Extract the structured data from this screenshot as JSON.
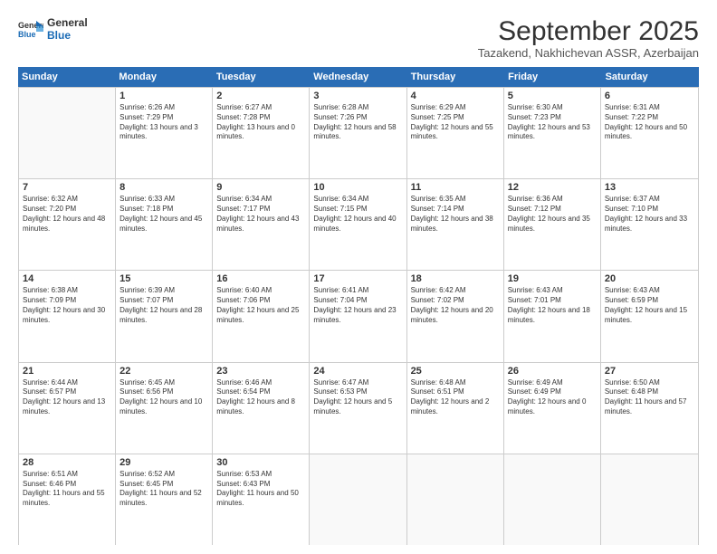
{
  "logo": {
    "line1": "General",
    "line2": "Blue"
  },
  "title": "September 2025",
  "location": "Tazakend, Nakhichevan ASSR, Azerbaijan",
  "days_of_week": [
    "Sunday",
    "Monday",
    "Tuesday",
    "Wednesday",
    "Thursday",
    "Friday",
    "Saturday"
  ],
  "weeks": [
    [
      {
        "day": "",
        "empty": true
      },
      {
        "day": "1",
        "sunrise": "Sunrise: 6:26 AM",
        "sunset": "Sunset: 7:29 PM",
        "daylight": "Daylight: 13 hours and 3 minutes."
      },
      {
        "day": "2",
        "sunrise": "Sunrise: 6:27 AM",
        "sunset": "Sunset: 7:28 PM",
        "daylight": "Daylight: 13 hours and 0 minutes."
      },
      {
        "day": "3",
        "sunrise": "Sunrise: 6:28 AM",
        "sunset": "Sunset: 7:26 PM",
        "daylight": "Daylight: 12 hours and 58 minutes."
      },
      {
        "day": "4",
        "sunrise": "Sunrise: 6:29 AM",
        "sunset": "Sunset: 7:25 PM",
        "daylight": "Daylight: 12 hours and 55 minutes."
      },
      {
        "day": "5",
        "sunrise": "Sunrise: 6:30 AM",
        "sunset": "Sunset: 7:23 PM",
        "daylight": "Daylight: 12 hours and 53 minutes."
      },
      {
        "day": "6",
        "sunrise": "Sunrise: 6:31 AM",
        "sunset": "Sunset: 7:22 PM",
        "daylight": "Daylight: 12 hours and 50 minutes."
      }
    ],
    [
      {
        "day": "7",
        "sunrise": "Sunrise: 6:32 AM",
        "sunset": "Sunset: 7:20 PM",
        "daylight": "Daylight: 12 hours and 48 minutes."
      },
      {
        "day": "8",
        "sunrise": "Sunrise: 6:33 AM",
        "sunset": "Sunset: 7:18 PM",
        "daylight": "Daylight: 12 hours and 45 minutes."
      },
      {
        "day": "9",
        "sunrise": "Sunrise: 6:34 AM",
        "sunset": "Sunset: 7:17 PM",
        "daylight": "Daylight: 12 hours and 43 minutes."
      },
      {
        "day": "10",
        "sunrise": "Sunrise: 6:34 AM",
        "sunset": "Sunset: 7:15 PM",
        "daylight": "Daylight: 12 hours and 40 minutes."
      },
      {
        "day": "11",
        "sunrise": "Sunrise: 6:35 AM",
        "sunset": "Sunset: 7:14 PM",
        "daylight": "Daylight: 12 hours and 38 minutes."
      },
      {
        "day": "12",
        "sunrise": "Sunrise: 6:36 AM",
        "sunset": "Sunset: 7:12 PM",
        "daylight": "Daylight: 12 hours and 35 minutes."
      },
      {
        "day": "13",
        "sunrise": "Sunrise: 6:37 AM",
        "sunset": "Sunset: 7:10 PM",
        "daylight": "Daylight: 12 hours and 33 minutes."
      }
    ],
    [
      {
        "day": "14",
        "sunrise": "Sunrise: 6:38 AM",
        "sunset": "Sunset: 7:09 PM",
        "daylight": "Daylight: 12 hours and 30 minutes."
      },
      {
        "day": "15",
        "sunrise": "Sunrise: 6:39 AM",
        "sunset": "Sunset: 7:07 PM",
        "daylight": "Daylight: 12 hours and 28 minutes."
      },
      {
        "day": "16",
        "sunrise": "Sunrise: 6:40 AM",
        "sunset": "Sunset: 7:06 PM",
        "daylight": "Daylight: 12 hours and 25 minutes."
      },
      {
        "day": "17",
        "sunrise": "Sunrise: 6:41 AM",
        "sunset": "Sunset: 7:04 PM",
        "daylight": "Daylight: 12 hours and 23 minutes."
      },
      {
        "day": "18",
        "sunrise": "Sunrise: 6:42 AM",
        "sunset": "Sunset: 7:02 PM",
        "daylight": "Daylight: 12 hours and 20 minutes."
      },
      {
        "day": "19",
        "sunrise": "Sunrise: 6:43 AM",
        "sunset": "Sunset: 7:01 PM",
        "daylight": "Daylight: 12 hours and 18 minutes."
      },
      {
        "day": "20",
        "sunrise": "Sunrise: 6:43 AM",
        "sunset": "Sunset: 6:59 PM",
        "daylight": "Daylight: 12 hours and 15 minutes."
      }
    ],
    [
      {
        "day": "21",
        "sunrise": "Sunrise: 6:44 AM",
        "sunset": "Sunset: 6:57 PM",
        "daylight": "Daylight: 12 hours and 13 minutes."
      },
      {
        "day": "22",
        "sunrise": "Sunrise: 6:45 AM",
        "sunset": "Sunset: 6:56 PM",
        "daylight": "Daylight: 12 hours and 10 minutes."
      },
      {
        "day": "23",
        "sunrise": "Sunrise: 6:46 AM",
        "sunset": "Sunset: 6:54 PM",
        "daylight": "Daylight: 12 hours and 8 minutes."
      },
      {
        "day": "24",
        "sunrise": "Sunrise: 6:47 AM",
        "sunset": "Sunset: 6:53 PM",
        "daylight": "Daylight: 12 hours and 5 minutes."
      },
      {
        "day": "25",
        "sunrise": "Sunrise: 6:48 AM",
        "sunset": "Sunset: 6:51 PM",
        "daylight": "Daylight: 12 hours and 2 minutes."
      },
      {
        "day": "26",
        "sunrise": "Sunrise: 6:49 AM",
        "sunset": "Sunset: 6:49 PM",
        "daylight": "Daylight: 12 hours and 0 minutes."
      },
      {
        "day": "27",
        "sunrise": "Sunrise: 6:50 AM",
        "sunset": "Sunset: 6:48 PM",
        "daylight": "Daylight: 11 hours and 57 minutes."
      }
    ],
    [
      {
        "day": "28",
        "sunrise": "Sunrise: 6:51 AM",
        "sunset": "Sunset: 6:46 PM",
        "daylight": "Daylight: 11 hours and 55 minutes."
      },
      {
        "day": "29",
        "sunrise": "Sunrise: 6:52 AM",
        "sunset": "Sunset: 6:45 PM",
        "daylight": "Daylight: 11 hours and 52 minutes."
      },
      {
        "day": "30",
        "sunrise": "Sunrise: 6:53 AM",
        "sunset": "Sunset: 6:43 PM",
        "daylight": "Daylight: 11 hours and 50 minutes."
      },
      {
        "day": "",
        "empty": true
      },
      {
        "day": "",
        "empty": true
      },
      {
        "day": "",
        "empty": true
      },
      {
        "day": "",
        "empty": true
      }
    ]
  ]
}
